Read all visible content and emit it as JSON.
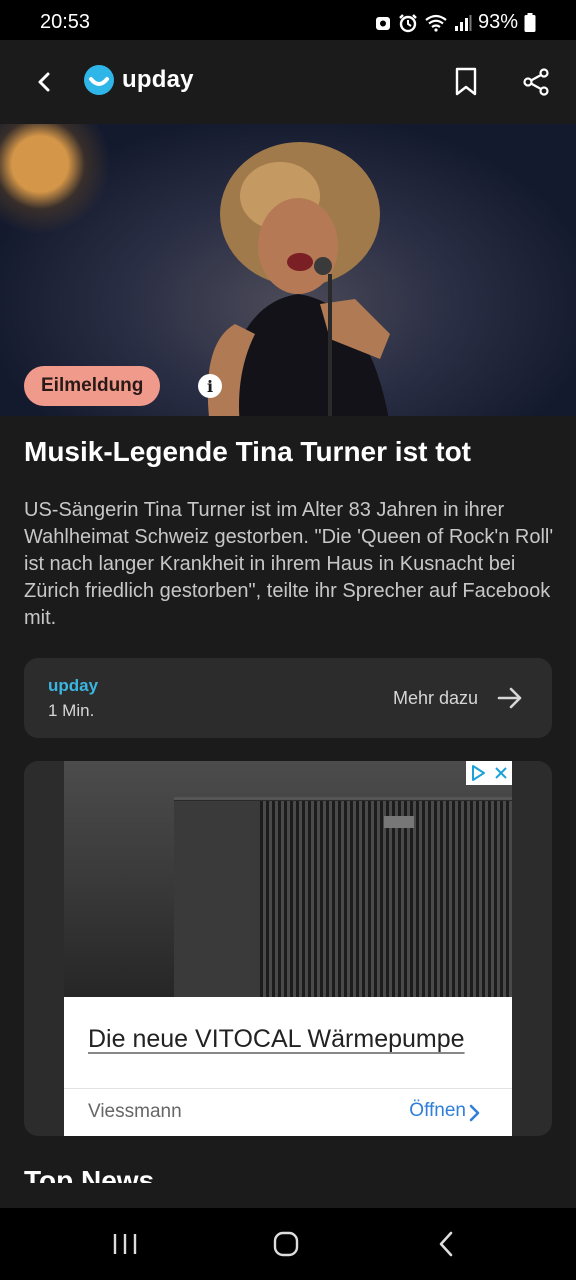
{
  "status_bar": {
    "time": "20:53",
    "battery": "93%"
  },
  "app_bar": {
    "brand": "upday",
    "brand_color": "#2fb6e8"
  },
  "article": {
    "badge": "Eilmeldung",
    "badge_color": "#f09a8c",
    "info_symbol": "i",
    "headline": "Musik-Legende Tina Turner ist tot",
    "summary": "US-Sängerin Tina Turner ist im Alter 83 Jahren in ihrer Wahlheimat Schweiz gestorben. \"Die 'Queen of Rock'n Roll' ist nach langer Krankheit in ihrem Haus in Kusnacht bei Zürich friedlich gestorben\", teilte ihr Sprecher auf Facebook mit."
  },
  "source_card": {
    "source": "upday",
    "read_time": "1 Min.",
    "more_label": "Mehr dazu"
  },
  "ad": {
    "title": "Die neue VITOCAL Wärmepumpe",
    "advertiser": "Viessmann",
    "cta": "Öffnen",
    "cta_color": "#2f7fd8"
  },
  "next_section": {
    "title": "Top News"
  },
  "icons": [
    "back-arrow-icon",
    "bookmark-icon",
    "share-icon",
    "info-icon",
    "arrow-right-icon",
    "ad-choices-icon",
    "close-icon",
    "chevron-right-icon",
    "recents-icon",
    "home-icon",
    "back-icon"
  ]
}
